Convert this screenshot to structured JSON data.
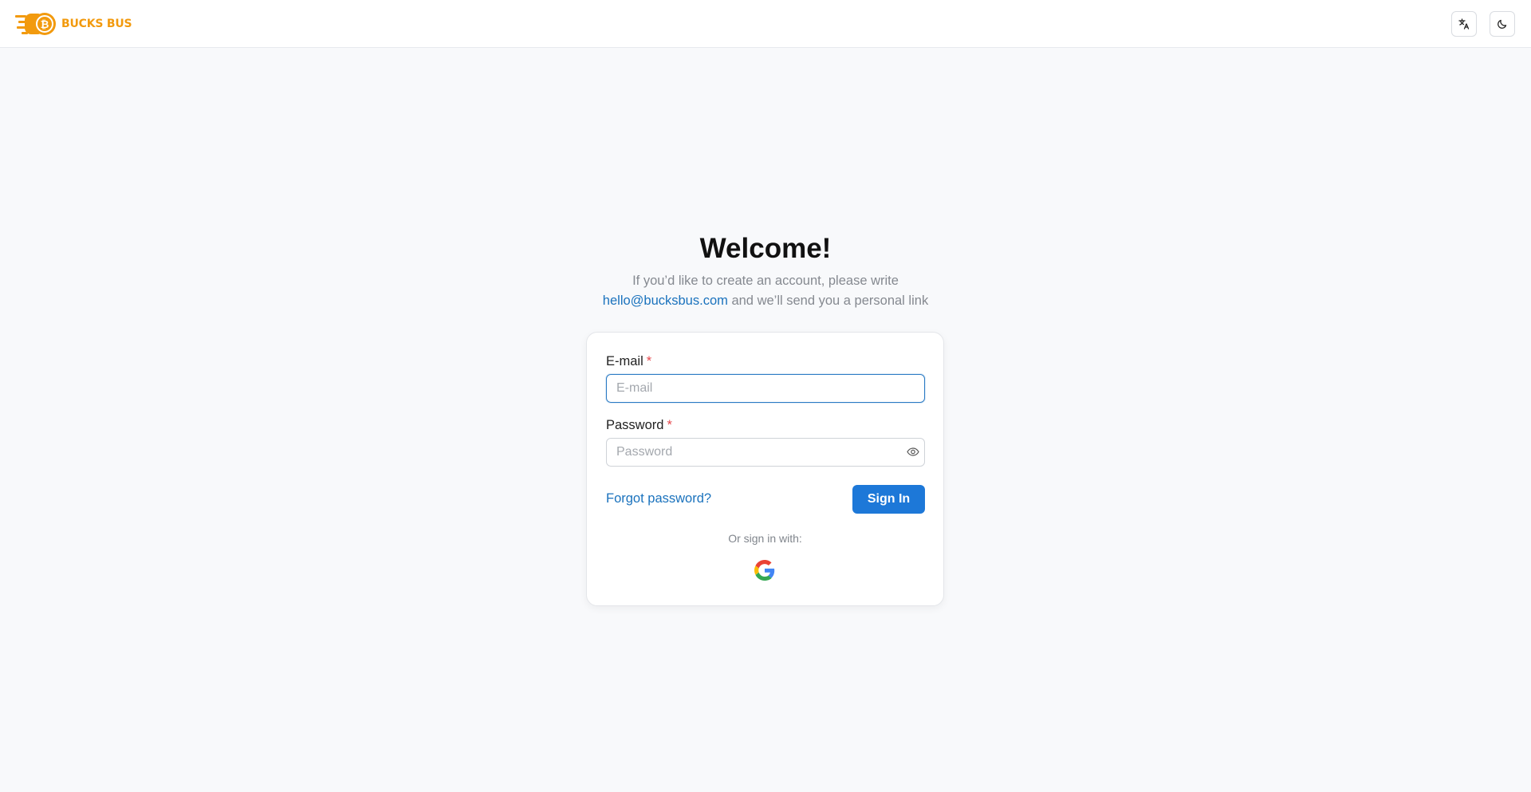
{
  "header": {
    "brand": "BUCKS BUS",
    "language_button": "translate-icon",
    "theme_button": "moon-icon"
  },
  "main": {
    "title": "Welcome!",
    "subtitle_line1": "If you’d like to create an account, please write",
    "contact_email": "hello@bucksbus.com",
    "subtitle_line2_suffix": " and we’ll send you a personal link"
  },
  "form": {
    "email_label": "E-mail",
    "email_placeholder": "E-mail",
    "email_value": "",
    "password_label": "Password",
    "password_placeholder": "Password",
    "password_value": "",
    "required_marker": "*",
    "forgot_label": "Forgot password?",
    "signin_label": "Sign In",
    "or_label": "Or sign in with:",
    "social_provider": "google-icon"
  },
  "colors": {
    "brand": "#f29a0e",
    "accent": "#1d78d8",
    "link": "#1a72bd",
    "required": "#e5484d"
  }
}
